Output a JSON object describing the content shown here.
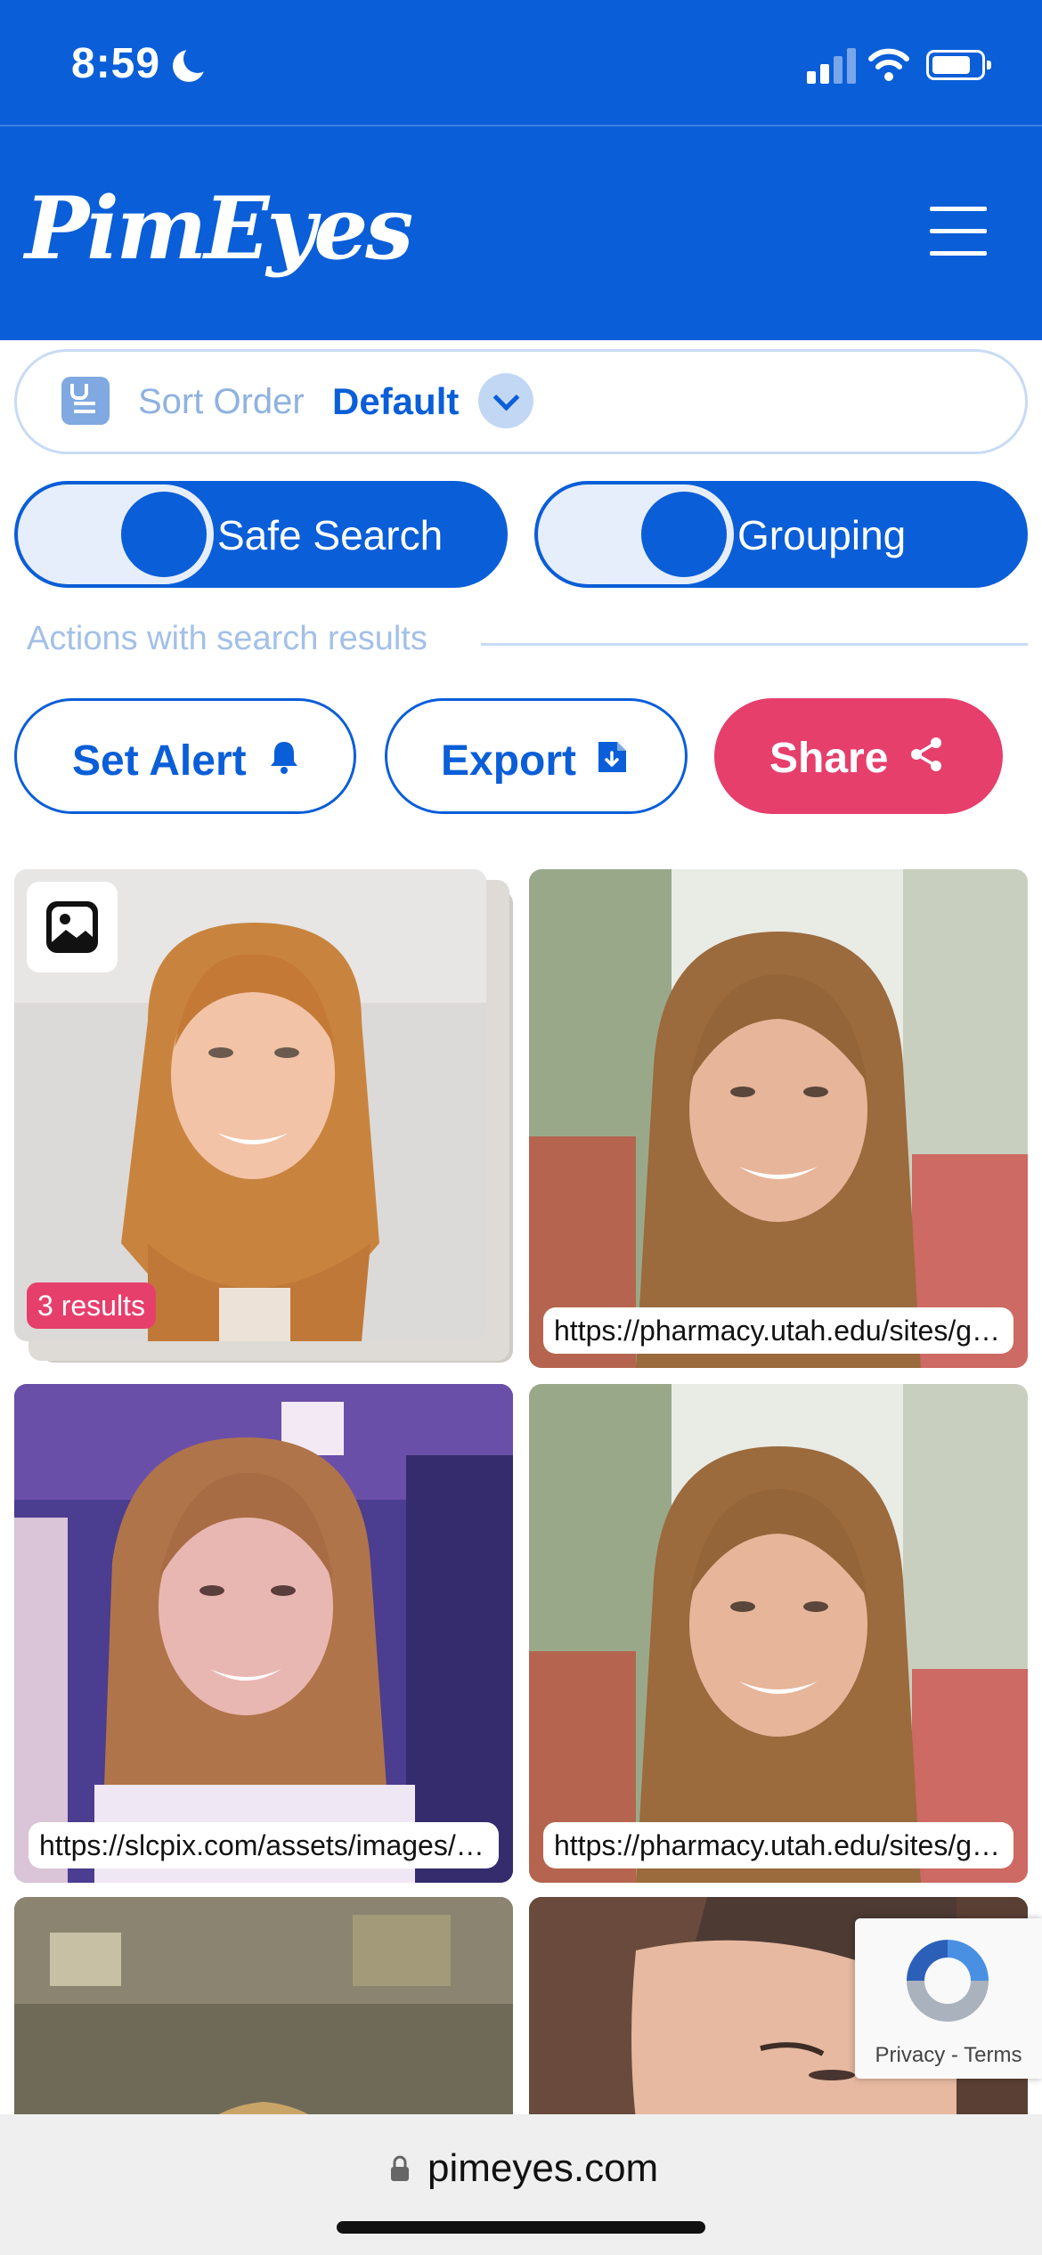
{
  "status_bar": {
    "time": "8:59",
    "icons": [
      "moon-icon",
      "signal-icon",
      "wifi-icon",
      "battery-icon"
    ]
  },
  "header": {
    "logo": "PimEyes",
    "menu_icon": "hamburger-icon"
  },
  "sort": {
    "label": "Sort Order",
    "value": "Default",
    "icon": "sort-list-icon",
    "chevron": "chevron-down-icon"
  },
  "toggles": {
    "safe_search": {
      "label": "Safe Search",
      "on": true
    },
    "grouping": {
      "label": "Grouping",
      "on": true
    }
  },
  "actions": {
    "section_label": "Actions with search results",
    "set_alert": {
      "label": "Set Alert",
      "icon": "bell-icon"
    },
    "export": {
      "label": "Export",
      "icon": "file-download-icon"
    },
    "share": {
      "label": "Share",
      "icon": "share-icon"
    }
  },
  "results": [
    {
      "badge": "3 results",
      "type_icon": "image-icon"
    },
    {
      "url": "https://pharmacy.utah.edu/sites/g…"
    },
    {
      "url": "https://slcpix.com/assets/images/…"
    },
    {
      "url": "https://pharmacy.utah.edu/sites/g…"
    },
    {},
    {}
  ],
  "recaptcha": {
    "text": "Privacy - Terms"
  },
  "browser": {
    "url": "pimeyes.com"
  },
  "colors": {
    "brand_blue": "#0a5ed8",
    "share_pink": "#e63f6c",
    "light_blue": "#c8dbf5"
  }
}
